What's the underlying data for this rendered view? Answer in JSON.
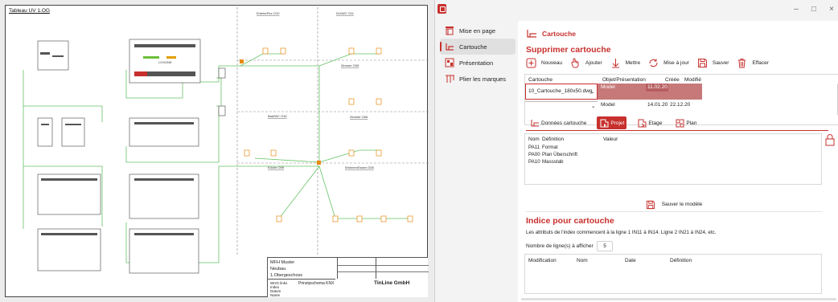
{
  "drawing": {
    "sheet_title": "Tableau UV 1.OG",
    "device_brand": "LOXONE",
    "rooms": [
      "Entrée/Flur O10",
      "DU/WC O11",
      "Zimmer O05",
      "Bad/WC O16",
      "Zimmer O06",
      "Küche O09",
      "Wohnen/Essen O08"
    ],
    "titleblock": {
      "client": [
        "MFH Muster",
        "Neubau",
        "1.Obergeschoss"
      ],
      "location": "WHG links",
      "schema": "Prinzipschema KNX",
      "company": "TinLine GmbH",
      "rows": [
        "Index",
        "Datum",
        "Name"
      ]
    }
  },
  "window": {
    "controls": {
      "minimize": "–",
      "maximize": "□",
      "close": "×"
    }
  },
  "sidebar": {
    "items": [
      {
        "label": "Mise en page",
        "icon": "page-layout-icon"
      },
      {
        "label": "Cartouche",
        "icon": "cartouche-icon",
        "active": true
      },
      {
        "label": "Présentation",
        "icon": "presentation-icon"
      },
      {
        "label": "Plier les marques",
        "icon": "fold-marks-icon"
      }
    ]
  },
  "main": {
    "heading": "Cartouche",
    "delete_section": "Supprimer cartouche",
    "toolbar": {
      "new": "Nouveau",
      "add": "Ajouter",
      "place": "Mettre",
      "update": "Mise à jour",
      "save": "Sauver",
      "erase": "Effacer"
    },
    "grid": {
      "headers": [
        "Cartouche",
        "Objet/Présentation",
        "Créée",
        "Modifié"
      ],
      "rows": [
        {
          "cartouche": "10_Cartouche_180x50.dwg",
          "object": "Model",
          "created": "11.02.20",
          "modified": ""
        },
        {
          "cartouche": "",
          "object": "Model",
          "created": "14.01.20",
          "modified": "22.12.20"
        }
      ]
    },
    "tabs": [
      {
        "label": "Données cartouche"
      },
      {
        "label": "Projet",
        "active": true
      },
      {
        "label": "Etage"
      },
      {
        "label": "Plan"
      }
    ],
    "params": {
      "headers": [
        "Nom",
        "Définition",
        "Valeur"
      ],
      "rows": [
        {
          "name": "PA11",
          "definition": "Format"
        },
        {
          "name": "PA00",
          "definition": "Plan Überschrift"
        },
        {
          "name": "PA10",
          "definition": "Massstab"
        }
      ]
    },
    "save_model": "Sauver le modèle",
    "index_section": "Indice pour cartouche",
    "index_note": "Les attributs de l'index commencent à la ligne 1 IN11 à IN14. Ligne 2 IN21 à IN24, etc.",
    "lines_label": "Nombre de ligne(s) à afficher",
    "lines_value": "5",
    "index_headers": [
      "Modification",
      "Nom",
      "Date",
      "Définition"
    ]
  },
  "colors": {
    "accent": "#c7302d",
    "wire": "#66c266",
    "device": "#e88a12"
  }
}
